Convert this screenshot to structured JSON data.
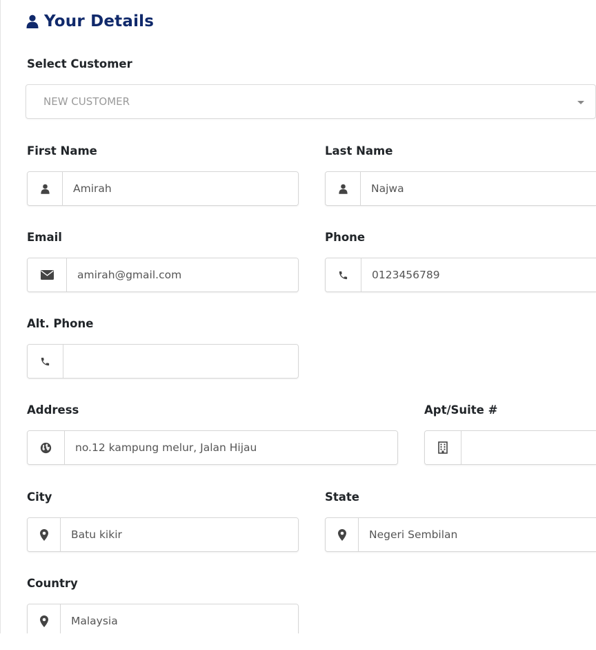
{
  "section": {
    "title": "Your Details"
  },
  "customer": {
    "label": "Select Customer",
    "selected": "NEW CUSTOMER"
  },
  "first_name": {
    "label": "First Name",
    "value": "Amirah"
  },
  "last_name": {
    "label": "Last Name",
    "value": "Najwa"
  },
  "email": {
    "label": "Email",
    "value": "amirah@gmail.com"
  },
  "phone": {
    "label": "Phone",
    "value": "0123456789"
  },
  "alt_phone": {
    "label": "Alt. Phone",
    "value": ""
  },
  "address": {
    "label": "Address",
    "value": "no.12 kampung melur, Jalan Hijau"
  },
  "apt": {
    "label": "Apt/Suite #",
    "value": ""
  },
  "city": {
    "label": "City",
    "value": "Batu kikir"
  },
  "state": {
    "label": "State",
    "value": "Negeri Sembilan"
  },
  "country": {
    "label": "Country",
    "value": "Malaysia"
  },
  "icons": {
    "title": "user-icon",
    "name": "user-icon",
    "email": "envelope-icon",
    "phone": "phone-icon",
    "address": "globe-icon",
    "apt": "building-icon",
    "location": "map-marker-icon"
  },
  "colors": {
    "title": "#10296b",
    "icon": "#444444",
    "border": "#d6d6d6"
  }
}
